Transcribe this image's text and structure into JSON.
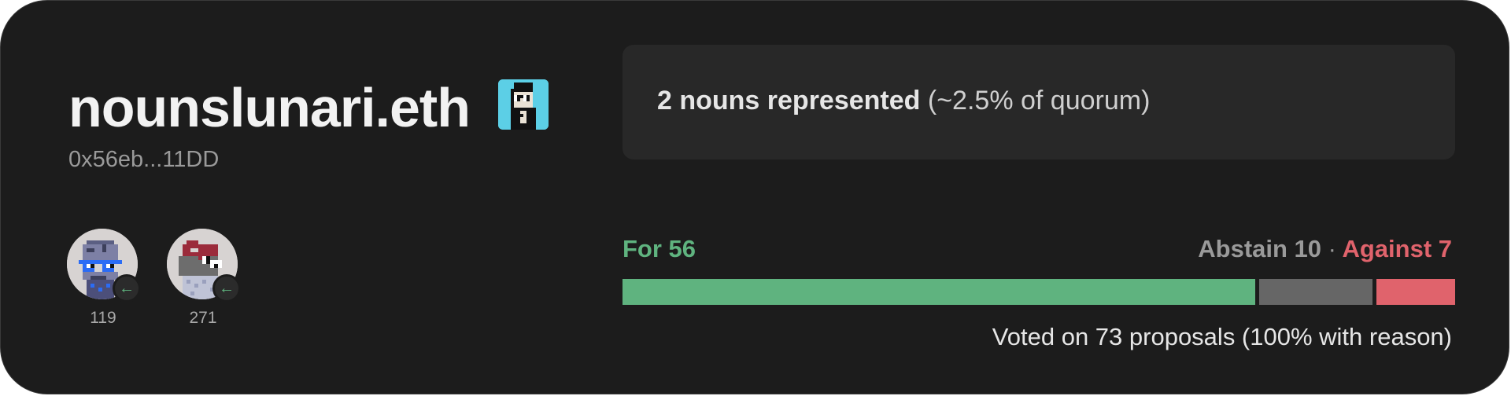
{
  "delegate": {
    "ens_name": "nounslunari.eth",
    "address": "0x56eb...11DD"
  },
  "nouns": [
    {
      "id": "119",
      "badge_icon": "arrow-left-icon"
    },
    {
      "id": "271",
      "badge_icon": "arrow-left-icon"
    }
  ],
  "representation": {
    "strong_text": "2 nouns represented",
    "muted_text": "(~2.5% of quorum)"
  },
  "votes": {
    "for_label": "For 56",
    "abstain_label": "Abstain 10",
    "separator": "·",
    "against_label": "Against 7",
    "for_count": 56,
    "abstain_count": 10,
    "against_count": 7,
    "voted_text": "Voted on 73 proposals (100% with reason)"
  },
  "colors": {
    "for": "#5fb37f",
    "abstain": "#666666",
    "against": "#e0636c",
    "avatar_bg": "#5ccfe6"
  }
}
